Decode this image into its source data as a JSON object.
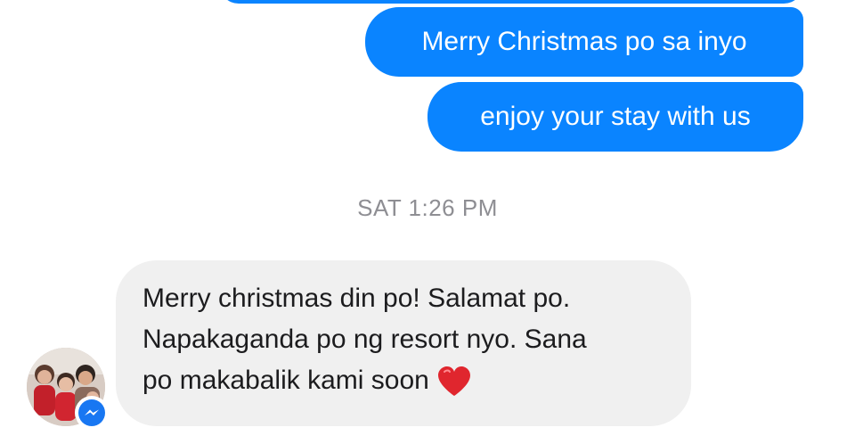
{
  "conversation": {
    "outgoing": [
      {
        "text": "Merry Christmas po sa inyo"
      },
      {
        "text": "enjoy your stay with us"
      }
    ],
    "timestamp": "SAT 1:26 PM",
    "incoming": {
      "lines": [
        "Merry christmas din po! Salamat po.",
        "Napakaganda po ng resort nyo. Sana",
        "po makabalik kami soon"
      ],
      "emoji": "heart-icon"
    }
  },
  "colors": {
    "outgoing_bubble": "#0a84ff",
    "incoming_bubble": "#f0f0f0",
    "timestamp_text": "#8e8e93",
    "heart": "#e0262e",
    "messenger_badge": "#1877f2"
  },
  "icons": {
    "avatar": "contact-avatar",
    "badge": "messenger-icon"
  }
}
